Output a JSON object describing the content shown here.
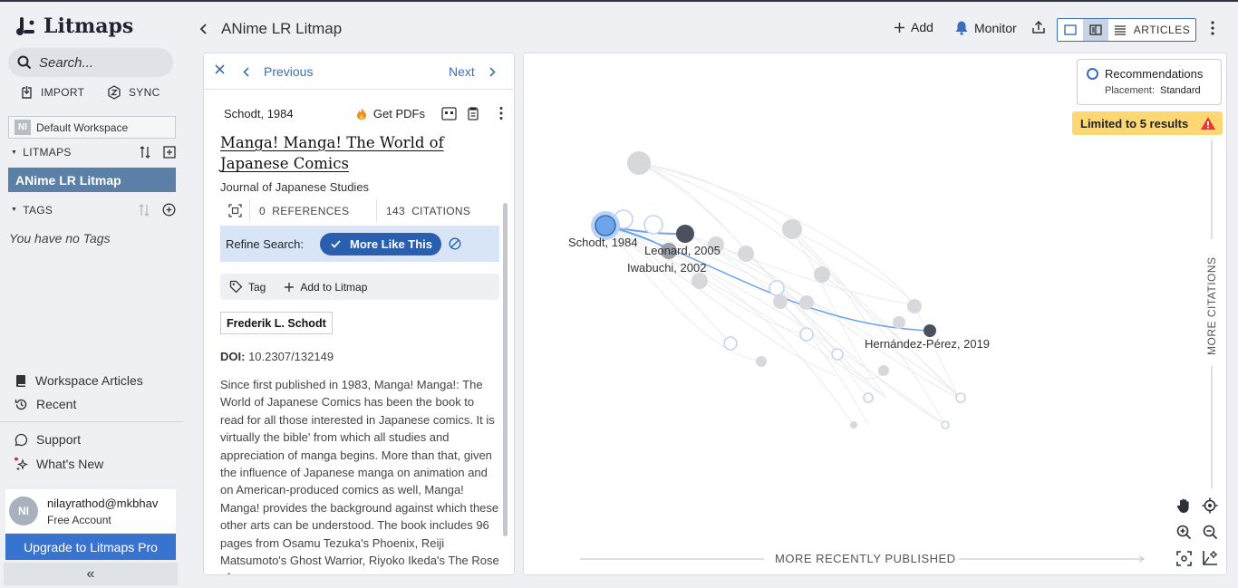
{
  "app": {
    "name": "Litmaps"
  },
  "sidebar": {
    "search_placeholder": "Search...",
    "import_label": "IMPORT",
    "sync_label": "SYNC",
    "workspace_badge": "NI",
    "workspace_name": "Default Workspace",
    "litmaps_header": "LITMAPS",
    "active_litmap": "ANime LR Litmap",
    "tags_header": "TAGS",
    "no_tags": "You have no Tags",
    "workspace_articles": "Workspace Articles",
    "recent": "Recent",
    "support": "Support",
    "whats_new": "What's New",
    "user": {
      "initials": "NI",
      "email": "nilayrathod@mkbhav",
      "account": "Free Account"
    },
    "upgrade_label": "Upgrade to Litmaps Pro",
    "collapse_glyph": "«"
  },
  "header": {
    "title": "ANime LR Litmap",
    "add_label": "Add",
    "monitor_label": "Monitor",
    "articles_label": "ARTICLES"
  },
  "article": {
    "previous_label": "Previous",
    "next_label": "Next",
    "author_year": "Schodt, 1984",
    "get_pdfs_label": "Get PDFs",
    "title": "Manga! Manga! The World of Japanese Comics",
    "journal": "Journal of Japanese Studies",
    "references_count": "0",
    "references_label": "REFERENCES",
    "citations_count": "143",
    "citations_label": "CITATIONS",
    "refine_label": "Refine Search:",
    "more_like_this_label": "More Like This",
    "tag_label": "Tag",
    "add_to_litmap_label": "Add to Litmap",
    "author": "Frederik L. Schodt",
    "doi_label": "DOI:",
    "doi_value": "10.2307/132149",
    "abstract": "Since first published in 1983, Manga! Manga!: The World of Japanese Comics has been the book to read for all those interested in Japanese comics. It is virtually the bible' from which all studies and appreciation of manga begins. More than that, given the influence of Japanese manga on animation and on American-produced comics as well, Manga! Manga! provides the background against which these other arts can be understood. The book includes 96 pages from Osamu Tezuka's Phoenix, Reiji Matsumoto's Ghost Warrior, Riyoko Ikeda's The Rose of"
  },
  "map": {
    "recommendations_title": "Recommendations",
    "placement_label": "Placement:",
    "placement_value": "Standard",
    "limit_label": "Limited to 5 results",
    "y_axis_label": "MORE CITATIONS",
    "x_axis_label": "MORE RECENTLY PUBLISHED",
    "node_labels": {
      "schodt": "Schodt, 1984",
      "leonard": "Leonard, 2005",
      "iwabuchi": "Iwabuchi, 2002",
      "hernandez": "Hernández-Pérez, 2019"
    },
    "colors": {
      "selected": "#6fa4ea",
      "accent": "#3a6fb8",
      "warning": "#fcd772"
    }
  }
}
